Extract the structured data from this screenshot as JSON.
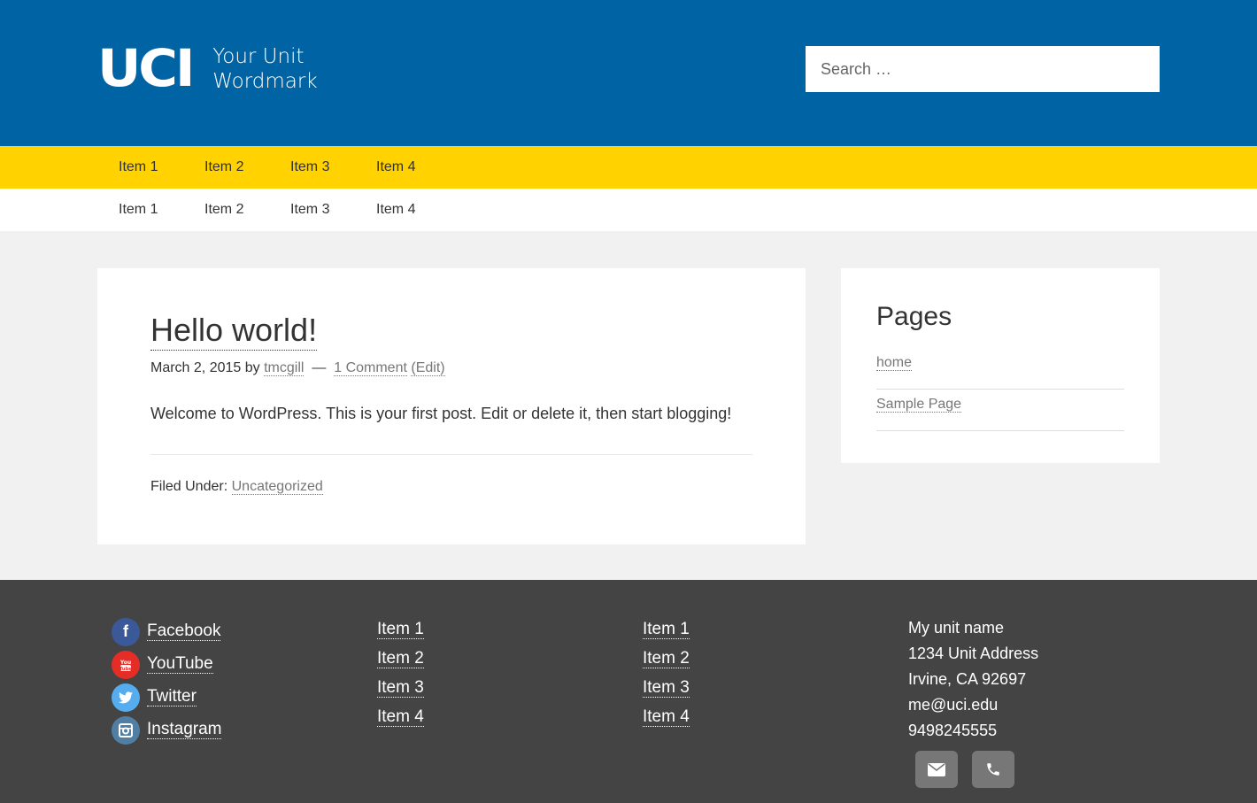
{
  "header": {
    "logo_mark": "UCI",
    "wordmark_line1": "Your Unit",
    "wordmark_line2": "Wordmark",
    "search_placeholder": "Search …"
  },
  "nav_primary": [
    "Item 1",
    "Item 2",
    "Item 3",
    "Item 4"
  ],
  "nav_secondary": [
    "Item 1",
    "Item 2",
    "Item 3",
    "Item 4"
  ],
  "post": {
    "title": "Hello world!",
    "date": "March 2, 2015",
    "by": "by",
    "author": "tmcgill",
    "dash": "—",
    "comments": "1 Comment",
    "edit": "(Edit)",
    "content": "Welcome to WordPress. This is your first post. Edit or delete it, then start blogging!",
    "filed_under": "Filed Under:",
    "category": "Uncategorized"
  },
  "sidebar": {
    "title": "Pages",
    "items": [
      "home",
      "Sample Page"
    ]
  },
  "footer": {
    "social": [
      {
        "label": "Facebook",
        "icon": "facebook-icon",
        "color": "#3b5998"
      },
      {
        "label": "YouTube",
        "icon": "youtube-icon",
        "color": "#e52d27"
      },
      {
        "label": "Twitter",
        "icon": "twitter-icon",
        "color": "#55acee"
      },
      {
        "label": "Instagram",
        "icon": "instagram-icon",
        "color": "#517fa4"
      }
    ],
    "col2": [
      "Item 1",
      "Item 2",
      "Item 3",
      "Item 4"
    ],
    "col3": [
      "Item 1",
      "Item 2",
      "Item 3",
      "Item 4"
    ],
    "contact": {
      "name": "My unit name",
      "address": "1234 Unit Address",
      "city": "Irvine, CA 92697",
      "email": "me@uci.edu",
      "phone": "9498245555"
    },
    "buttons": [
      "envelope-icon",
      "phone-icon"
    ]
  },
  "colors": {
    "header_blue": "#0064a4",
    "nav_gold": "#ffd200",
    "footer_gray": "#444444"
  }
}
